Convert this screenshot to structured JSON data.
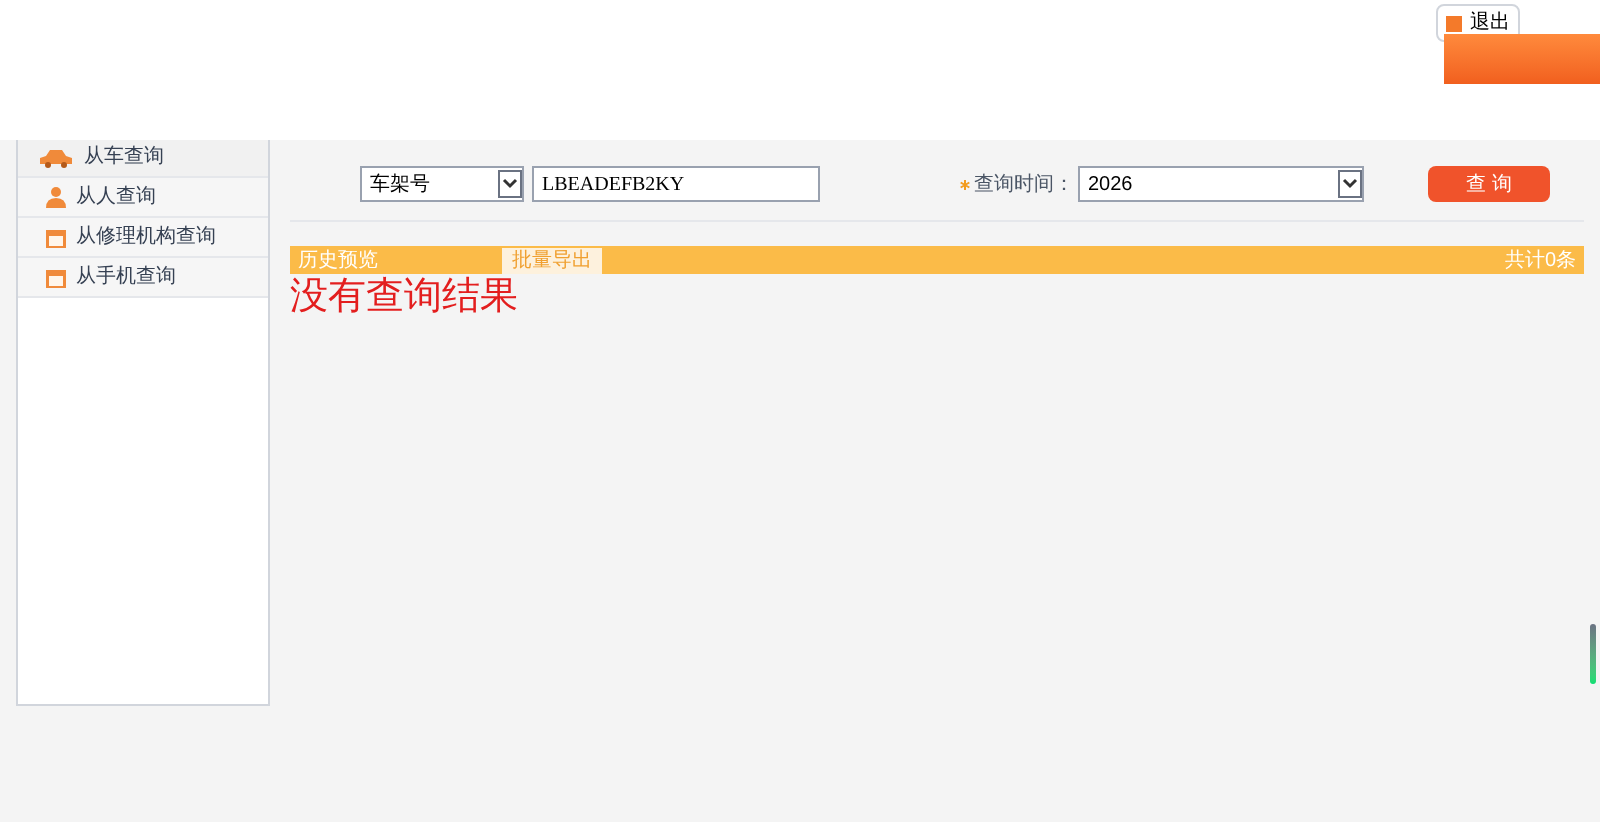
{
  "header": {
    "logout": "退出"
  },
  "sidebar": {
    "items": [
      {
        "label": "从车查询",
        "kind": "car",
        "selected": true
      },
      {
        "label": "从人查询",
        "kind": "person",
        "selected": false
      },
      {
        "label": "从修理机构查询",
        "kind": "calendar",
        "selected": false
      },
      {
        "label": "从手机查询",
        "kind": "calendar",
        "selected": false
      }
    ]
  },
  "search": {
    "type_select": "车架号",
    "vin_value": "LBEADEFB2KY",
    "time_label": "查询时间：",
    "time_select": "2026",
    "query_button": "查 询"
  },
  "results": {
    "tab": "历史预览",
    "export_button": "批量导出",
    "count": "共计0条",
    "empty_message": "没有查询结果"
  }
}
